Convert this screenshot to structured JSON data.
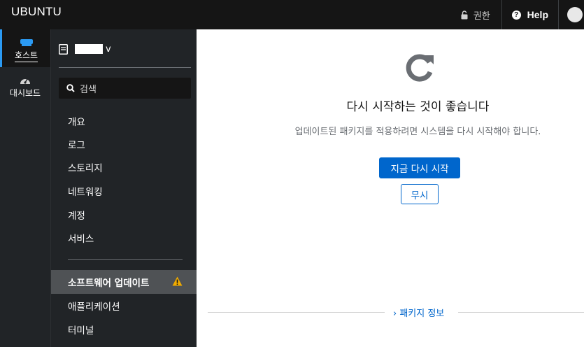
{
  "topbar": {
    "brand": "UBUNTU",
    "permissions_label": "권한",
    "help_label": "Help",
    "icons": {
      "lock": "lock-icon",
      "help": "help-circle-icon",
      "user": "user-avatar"
    }
  },
  "rail": {
    "items": [
      {
        "label": "호스트",
        "icon": "server-icon",
        "active": true
      },
      {
        "label": "대시보드",
        "icon": "dashboard-gauge-icon",
        "active": false
      }
    ]
  },
  "nav": {
    "host_suffix": "v",
    "search_placeholder": "검색",
    "items": [
      {
        "label": "개요"
      },
      {
        "label": "로그"
      },
      {
        "label": "스토리지"
      },
      {
        "label": "네트워킹"
      },
      {
        "label": "계정"
      },
      {
        "label": "서비스"
      }
    ],
    "items_after_sep": [
      {
        "label": "소프트웨어 업데이트",
        "active": true,
        "warning": true
      },
      {
        "label": "애플리케이션"
      },
      {
        "label": "터미널"
      }
    ]
  },
  "main": {
    "title": "다시 시작하는 것이 좋습니다",
    "body": "업데이트된 패키지를 적용하려면 시스템을 다시 시작해야 합니다.",
    "primary_button": "지금 다시 시작",
    "secondary_button": "무시",
    "expander": "› 패키지 정보"
  },
  "colors": {
    "topbar_bg": "#151515",
    "sidebar_bg": "#212427",
    "active_item_bg": "#4f5255",
    "accent": "#0066cc",
    "warning": "#f0ab00"
  }
}
